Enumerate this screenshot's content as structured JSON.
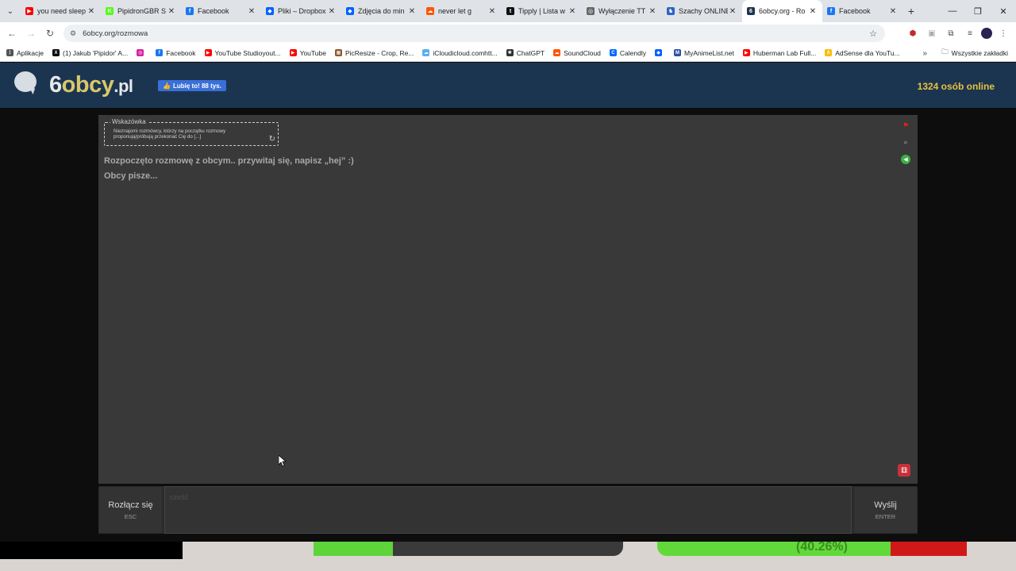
{
  "browser": {
    "tabs": [
      {
        "label": "you need sleep",
        "icon": "youtube-icon",
        "color": "#ff0000",
        "glyph": "▶"
      },
      {
        "label": "PipidronGBR S",
        "icon": "kick-icon",
        "color": "#53fc18",
        "glyph": "K"
      },
      {
        "label": "Facebook",
        "icon": "facebook-icon",
        "color": "#1877f2",
        "glyph": "f"
      },
      {
        "label": "Pliki – Dropbox",
        "icon": "dropbox-icon",
        "color": "#0061fe",
        "glyph": "◆"
      },
      {
        "label": "Zdjęcia do min",
        "icon": "dropbox-icon",
        "color": "#0061fe",
        "glyph": "◆"
      },
      {
        "label": "never let g",
        "icon": "soundcloud-icon",
        "color": "#ff5500",
        "glyph": "☁"
      },
      {
        "label": "Tipply | Lista w",
        "icon": "tipply-icon",
        "color": "#111111",
        "glyph": "t"
      },
      {
        "label": "Wyłączenie TT",
        "icon": "globe-icon",
        "color": "#666666",
        "glyph": "◎"
      },
      {
        "label": "Szachy ONLINE",
        "icon": "chess-icon",
        "color": "#2f64c5",
        "glyph": "♞"
      },
      {
        "label": "6obcy.org - Ro",
        "icon": "6obcy-icon",
        "color": "#1b3551",
        "glyph": "6"
      },
      {
        "label": "Facebook",
        "icon": "facebook-icon",
        "color": "#1877f2",
        "glyph": "f"
      }
    ],
    "active_tab_index": 9,
    "address": "6obcy.org/rozmowa",
    "bookmarks": [
      {
        "label": "Aplikacje",
        "icon": "apps-icon",
        "color": "#555555",
        "glyph": "⋮"
      },
      {
        "label": "(1) Jakub 'Pipidor' A...",
        "icon": "x-icon",
        "color": "#000000",
        "glyph": "X"
      },
      {
        "label": "",
        "icon": "instagram-icon",
        "color": "#d6249f",
        "glyph": "◎"
      },
      {
        "label": "Facebook",
        "icon": "facebook-icon",
        "color": "#1877f2",
        "glyph": "f"
      },
      {
        "label": "YouTube Studioyout...",
        "icon": "youtube-icon",
        "color": "#ff0000",
        "glyph": "▶"
      },
      {
        "label": "YouTube",
        "icon": "youtube-icon",
        "color": "#ff0000",
        "glyph": "▶"
      },
      {
        "label": "PicResize - Crop, Re...",
        "icon": "picresize-icon",
        "color": "#8a5a2b",
        "glyph": "▦"
      },
      {
        "label": "iCloudicloud.comhtt...",
        "icon": "icloud-icon",
        "color": "#5ab0f0",
        "glyph": "☁"
      },
      {
        "label": "ChatGPT",
        "icon": "chatgpt-icon",
        "color": "#333333",
        "glyph": "✺"
      },
      {
        "label": "SoundCloud",
        "icon": "soundcloud-icon",
        "color": "#ff5500",
        "glyph": "☁"
      },
      {
        "label": "Calendly",
        "icon": "calendly-icon",
        "color": "#006bff",
        "glyph": "C"
      },
      {
        "label": "",
        "icon": "dropbox-icon",
        "color": "#0061fe",
        "glyph": "◆"
      },
      {
        "label": "MyAnimeList.net",
        "icon": "myanimelist-icon",
        "color": "#2e51a2",
        "glyph": "M"
      },
      {
        "label": "Huberman Lab Full...",
        "icon": "youtube-icon",
        "color": "#ff0000",
        "glyph": "▶"
      },
      {
        "label": "AdSense dla YouTu...",
        "icon": "adsense-icon",
        "color": "#fbbc04",
        "glyph": "A"
      }
    ],
    "all_bookmarks": "Wszystkie zakładki"
  },
  "site": {
    "logo_main": "6",
    "logo_accent": "obcy",
    "logo_domain": ".pl",
    "fb_like": "Lubię to! 88 tys.",
    "online_count": "1324 osób online"
  },
  "chat": {
    "hint_title": "Wskazówka",
    "hint_text": "Nieznajomi rozmówcy, którzy na początku rozmowy proponują/próbują przekonać Cię do [...]",
    "messages": [
      "Rozpoczęto rozmowę z obcym.. przywitaj się, napisz „hej” :)",
      "Obcy pisze..."
    ]
  },
  "input_bar": {
    "disconnect_label": "Rozłącz się",
    "disconnect_key": "ESC",
    "placeholder": "cześć",
    "send_label": "Wyślij",
    "send_key": "ENTER"
  },
  "overlay": {
    "percent_text": "(40.26%)"
  }
}
